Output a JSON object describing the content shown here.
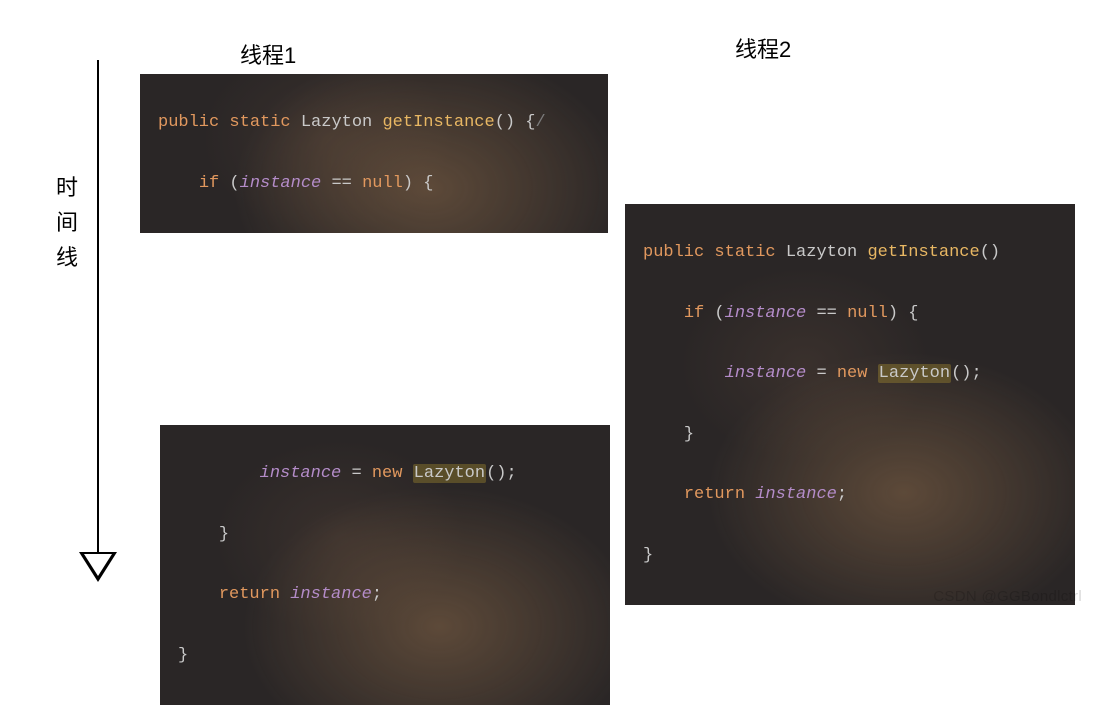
{
  "axis_label": "时\n间\n线",
  "columns": {
    "thread1": "线程1",
    "thread2": "线程2"
  },
  "code": {
    "kw_public": "public",
    "kw_static": "static",
    "kw_if": "if",
    "kw_new": "new",
    "kw_null": "null",
    "kw_return": "return",
    "type_lazyton": "Lazyton",
    "method_getinstance": "getInstance",
    "ident_instance": "instance",
    "op_eq": "==",
    "op_assign": "=",
    "paren_open": "(",
    "paren_close": ")",
    "brace_open": "{",
    "brace_close": "}",
    "semicolon": ";",
    "slash": "/"
  },
  "watermark": "CSDN @GGBondlctrl"
}
